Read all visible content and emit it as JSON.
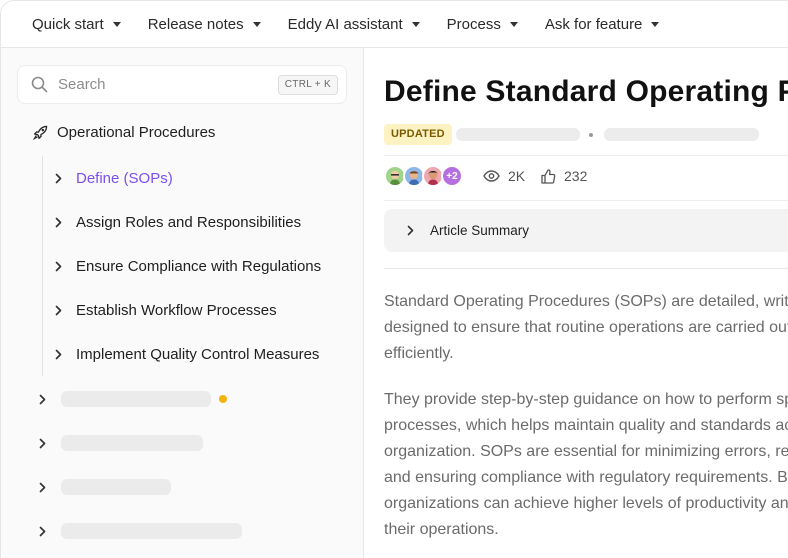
{
  "nav": {
    "items": [
      {
        "label": "Quick start"
      },
      {
        "label": "Release notes"
      },
      {
        "label": "Eddy AI assistant"
      },
      {
        "label": "Process"
      },
      {
        "label": "Ask for feature"
      }
    ]
  },
  "search": {
    "placeholder": "Search",
    "shortcut": "CTRL + K"
  },
  "sidebar": {
    "section_title": "Operational Procedures",
    "items": [
      {
        "label": "Define (SOPs)"
      },
      {
        "label": "Assign Roles and Responsibilities"
      },
      {
        "label": "Ensure Compliance with Regulations"
      },
      {
        "label": "Establish Workflow Processes"
      },
      {
        "label": "Implement Quality Control Measures"
      }
    ]
  },
  "article": {
    "title": "Define Standard Operating Procedures (SOPs)",
    "badge": "UPDATED",
    "avatars_more": "+2",
    "views": "2K",
    "likes": "232",
    "summary_label": "Article Summary",
    "paragraph1": [
      "Standard Operating Procedures (SOPs) are detailed, written instructions",
      "designed to ensure that routine operations are carried out consistently and",
      "efficiently."
    ],
    "paragraph2": [
      "They provide step-by-step guidance on how to perform specific tasks or",
      "processes, which helps maintain quality and standards across the",
      "organization. SOPs are essential for minimizing errors, reducing variability,",
      "and ensuring compliance with regulatory requirements. By using SOPs,",
      "organizations can achieve higher levels of productivity and consistency in",
      "their operations."
    ]
  },
  "colors": {
    "accent": "#7b4ff0",
    "badge_bg": "#fdf2c2",
    "notification_dot": "#f4b20f",
    "avatar_more_bg": "#b66fe0"
  }
}
